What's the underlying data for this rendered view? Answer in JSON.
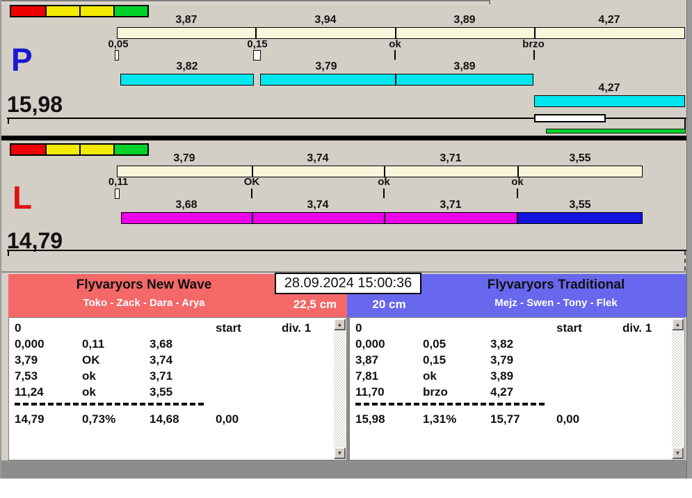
{
  "panels": [
    {
      "letter": "P",
      "total": "15,98",
      "plan_labels": [
        "3,87",
        "3,94",
        "3,89",
        "4,27"
      ],
      "markers": [
        "0,05",
        "0,15",
        "ok",
        "brzo"
      ],
      "actual_labels": [
        "3,82",
        "3,79",
        "3,89",
        "4,27"
      ]
    },
    {
      "letter": "L",
      "total": "14,79",
      "plan_labels": [
        "3,79",
        "3,74",
        "3,71",
        "3,55"
      ],
      "markers": [
        "0,11",
        "OK",
        "ok",
        "ok"
      ],
      "actual_labels": [
        "3,68",
        "3,74",
        "3,71",
        "3,55"
      ]
    }
  ],
  "datetime": "28.09.2024 15:00:36",
  "tables": [
    {
      "title": "Flyvaryors New Wave",
      "members": "Toko - Zack - Dara - Arya",
      "board": "22,5 cm",
      "rows": [
        [
          "0",
          "",
          "",
          "start",
          "div. 1"
        ],
        [
          "0,000",
          "0,11",
          "3,68",
          "",
          ""
        ],
        [
          "3,79",
          "OK",
          "3,74",
          "",
          ""
        ],
        [
          "7,53",
          "ok",
          "3,71",
          "",
          ""
        ],
        [
          "11,24",
          "ok",
          "3,55",
          "",
          ""
        ]
      ],
      "totals": [
        "14,79",
        "0,73%",
        "14,68",
        "0,00"
      ]
    },
    {
      "title": "Flyvaryors Traditional",
      "members": "Mejz - Swen - Tony - Flek",
      "board": "20 cm",
      "rows": [
        [
          "0",
          "",
          "",
          "start",
          "div. 1"
        ],
        [
          "0,000",
          "0,05",
          "3,82",
          "",
          ""
        ],
        [
          "3,87",
          "0,15",
          "3,79",
          "",
          ""
        ],
        [
          "7,81",
          "ok",
          "3,89",
          "",
          ""
        ],
        [
          "11,70",
          "brzo",
          "4,27",
          "",
          ""
        ]
      ],
      "totals": [
        "15,98",
        "1,31%",
        "15,77",
        "0,00"
      ]
    }
  ],
  "icons": {
    "scroll_up": "▲",
    "scroll_down": "▼"
  },
  "colors": {
    "panel_background": "#d3cfc6",
    "team_red_header": "#f56868",
    "team_blue_header": "#6868ef",
    "plan_bar": "#f9f6dc",
    "cyan_bar": "#00e6ef",
    "magenta_bar": "#ea00ea",
    "blue_bar": "#1212dd",
    "green_bar": "#00d22a",
    "letter_p": "#1a18d0",
    "letter_l": "#dd1414",
    "legend_blocks": [
      "#ee0000",
      "#f2ea00",
      "#f2ea00",
      "#00d22a"
    ]
  }
}
